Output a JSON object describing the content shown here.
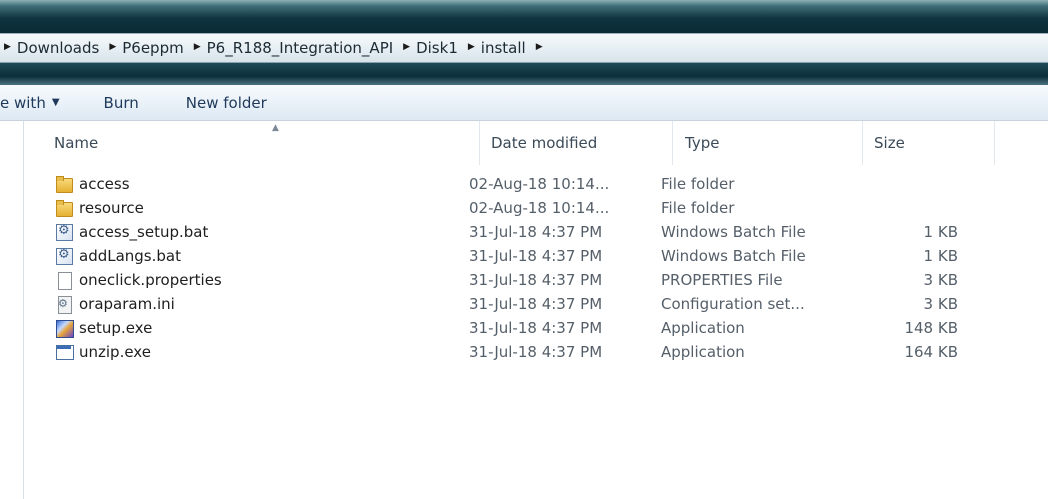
{
  "breadcrumb": {
    "items": [
      "Downloads",
      "P6eppm",
      "P6_R188_Integration_API",
      "Disk1",
      "install"
    ]
  },
  "toolbar": {
    "share_label": "e with",
    "burn_label": "Burn",
    "new_folder_label": "New folder"
  },
  "columns": {
    "name": "Name",
    "date": "Date modified",
    "type": "Type",
    "size": "Size"
  },
  "files": [
    {
      "name": "access",
      "date": "02-Aug-18 10:14...",
      "type": "File folder",
      "size": "",
      "icon": "folder-icon"
    },
    {
      "name": "resource",
      "date": "02-Aug-18 10:14...",
      "type": "File folder",
      "size": "",
      "icon": "folder-icon"
    },
    {
      "name": "access_setup.bat",
      "date": "31-Jul-18 4:37 PM",
      "type": "Windows Batch File",
      "size": "1 KB",
      "icon": "batch-file-icon"
    },
    {
      "name": "addLangs.bat",
      "date": "31-Jul-18 4:37 PM",
      "type": "Windows Batch File",
      "size": "1 KB",
      "icon": "batch-file-icon"
    },
    {
      "name": "oneclick.properties",
      "date": "31-Jul-18 4:37 PM",
      "type": "PROPERTIES File",
      "size": "3 KB",
      "icon": "file-icon"
    },
    {
      "name": "oraparam.ini",
      "date": "31-Jul-18 4:37 PM",
      "type": "Configuration set...",
      "size": "3 KB",
      "icon": "config-file-icon"
    },
    {
      "name": "setup.exe",
      "date": "31-Jul-18 4:37 PM",
      "type": "Application",
      "size": "148 KB",
      "icon": "setup-app-icon"
    },
    {
      "name": "unzip.exe",
      "date": "31-Jul-18 4:37 PM",
      "type": "Application",
      "size": "164 KB",
      "icon": "app-icon"
    }
  ]
}
